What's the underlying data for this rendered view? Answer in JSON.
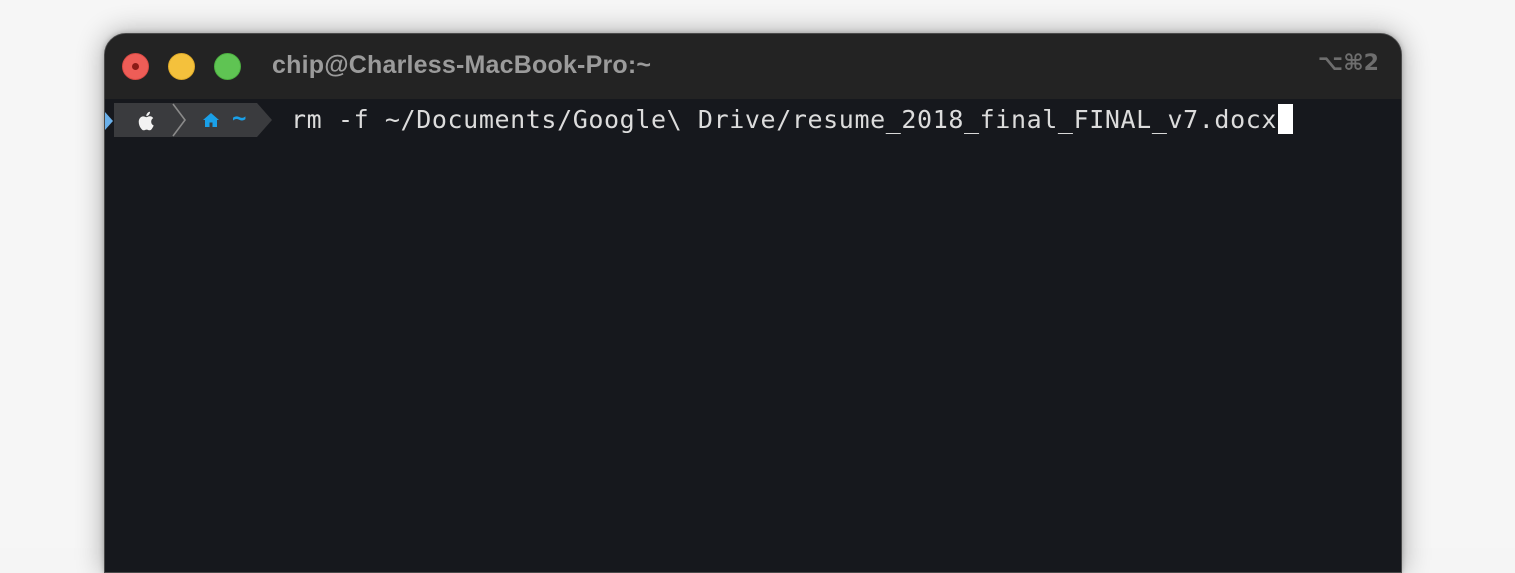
{
  "window": {
    "title": "chip@Charless-MacBook-Pro:~",
    "shortcut": "⌥⌘2"
  },
  "prompt": {
    "os_icon": "apple-icon",
    "dir_icon": "home-icon",
    "directory": "~",
    "segment_color": "#3a3b3e",
    "accent_color": "#1aa0e8"
  },
  "terminal": {
    "command": "rm -f ~/Documents/Google\\ Drive/resume_2018_final_FINAL_v7.docx",
    "background": "#16181d",
    "text_color": "#dcdcdc"
  },
  "colors": {
    "close": "#ee5d57",
    "minimize": "#f4c13c",
    "maximize": "#5fc453"
  }
}
